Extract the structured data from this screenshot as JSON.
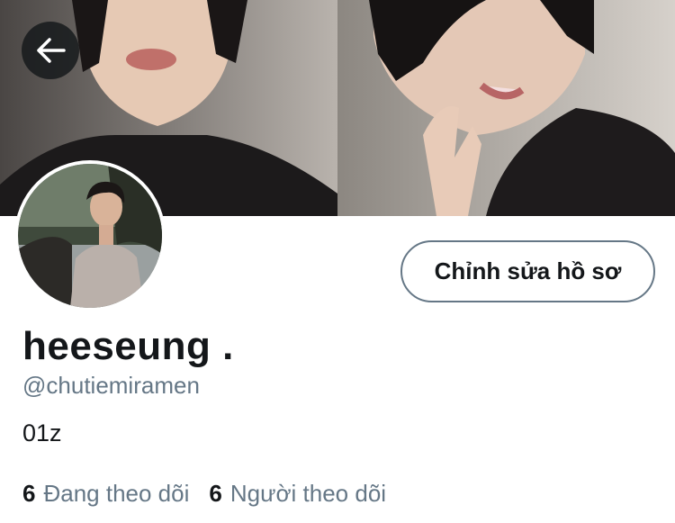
{
  "header": {
    "back_icon": "arrow-left-icon"
  },
  "profile": {
    "display_name": "heeseung .",
    "handle": "@chutiemiramen",
    "bio": "01z",
    "edit_button_label": "Chỉnh sửa hồ sơ"
  },
  "stats": {
    "following_count": "6",
    "following_label": "Đang theo dõi",
    "followers_count": "6",
    "followers_label": "Người theo dõi"
  },
  "colors": {
    "text_primary": "#14171a",
    "text_secondary": "#657786",
    "border": "#657786",
    "back_button_bg": "#14171a"
  }
}
